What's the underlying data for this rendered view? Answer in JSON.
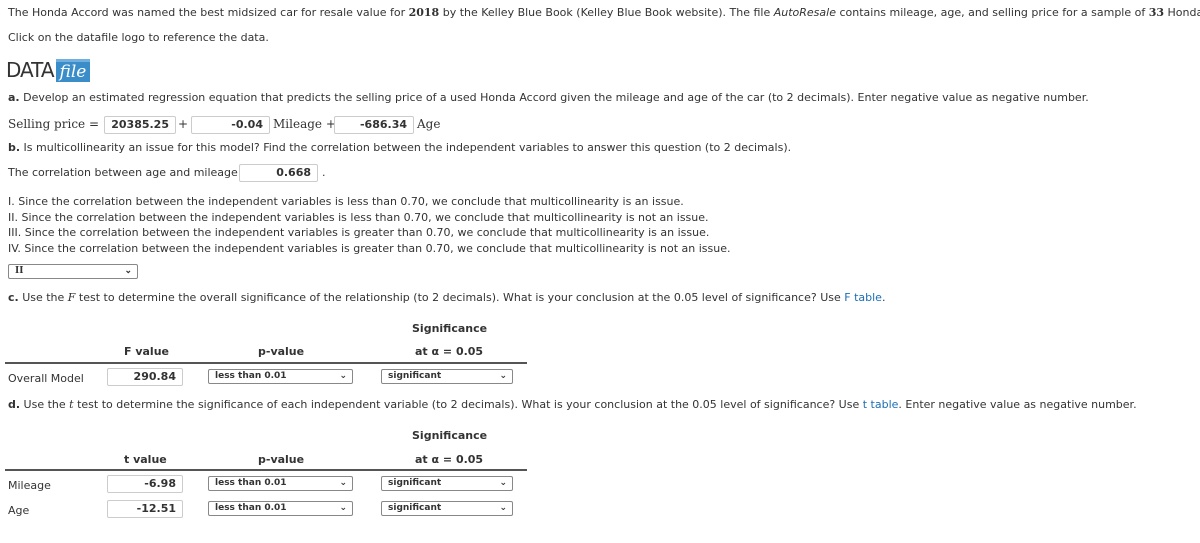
{
  "intro": {
    "line1_pre": "The Honda Accord was named the best midsized car for resale value for ",
    "year": "2018",
    "line1_mid": " by the Kelley Blue Book (Kelley Blue Book website). The file ",
    "file": "AutoResale",
    "line1_post": " contains mileage, age, and selling price for a sample of ",
    "n": "33",
    "line1_end": " Honda Accords.",
    "line2": "Click on the datafile logo to reference the data."
  },
  "logo": {
    "data": "DATA",
    "file": "file",
    "color": "#3a8dc9"
  },
  "a": {
    "label": "a.",
    "text": " Develop an estimated regression equation that predicts the selling price of a used Honda Accord given the mileage and age of the car (to 2 decimals). Enter negative value as negative number.",
    "lhs": "Selling price =",
    "b0": "20385.25",
    "plus1": "+",
    "b1": "-0.04",
    "mileage": "Mileage +",
    "b2": "-686.34",
    "age": "Age"
  },
  "b": {
    "label": "b.",
    "text": " Is multicollinearity an issue for this model? Find the correlation between the independent variables to answer this question (to 2 decimals).",
    "corr_label": "The correlation between age and mileage is",
    "corr": "0.668",
    "period": ".",
    "options": [
      "I. Since the correlation between the independent variables is less than 0.70, we conclude that multicollinearity is an issue.",
      "II. Since the correlation between the independent variables is less than 0.70, we conclude that multicollinearity is not an issue.",
      "III. Since the correlation between the independent variables is greater than 0.70, we conclude that multicollinearity is an issue.",
      "IV. Since the correlation between the independent variables is greater than 0.70, we conclude that multicollinearity is not an issue."
    ],
    "selected": "II"
  },
  "c": {
    "label": "c.",
    "text_pre": " Use the ",
    "F": "F",
    "text_post": " test to determine the overall significance of the relationship (to 2 decimals). What is your conclusion at the 0.05 level of significance? Use ",
    "link": "F table",
    "end": ".",
    "h_sig": "Significance",
    "h_val": "F value",
    "h_p": "p-value",
    "h_alpha": "at α = 0.05",
    "row": {
      "label": "Overall Model",
      "value": "290.84",
      "p": "less than 0.01",
      "sig": "significant"
    }
  },
  "d": {
    "label": "d.",
    "text_pre": " Use the ",
    "t": "t",
    "text_post": " test to determine the significance of each independent variable (to 2 decimals). What is your conclusion at the 0.05 level of significance? Use ",
    "link": "t table",
    "end": ". Enter negative value as negative number.",
    "h_sig": "Significance",
    "h_val": "t value",
    "h_p": "p-value",
    "h_alpha": "at α = 0.05",
    "rows": [
      {
        "label": "Mileage",
        "value": "-6.98",
        "p": "less than 0.01",
        "sig": "significant"
      },
      {
        "label": "Age",
        "value": "-12.51",
        "p": "less than 0.01",
        "sig": "significant"
      }
    ]
  }
}
